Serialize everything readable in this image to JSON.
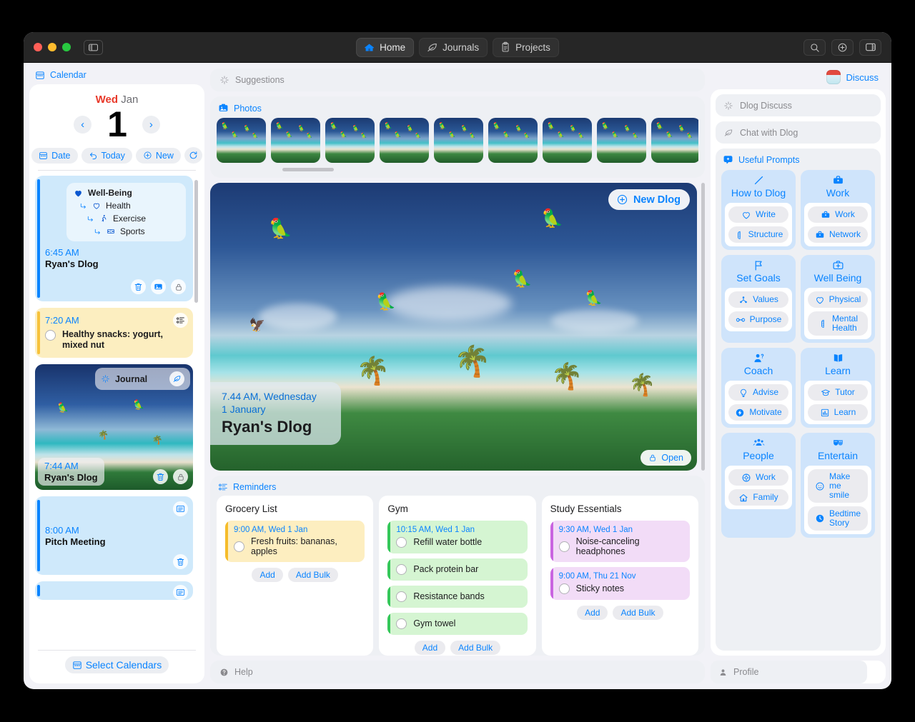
{
  "titlebar": {
    "sidebar_toggle": "sidebar-toggle",
    "tabs": [
      {
        "label": "Home",
        "icon": "home-icon",
        "active": true
      },
      {
        "label": "Journals",
        "icon": "leaf-icon",
        "active": false
      },
      {
        "label": "Projects",
        "icon": "clipboard-icon",
        "active": false
      }
    ],
    "tools": [
      "search-icon",
      "plus-icon",
      "inspector-icon"
    ]
  },
  "sidebar": {
    "section_label": "Calendar",
    "date": {
      "weekday": "Wed",
      "month": "Jan",
      "day": "1"
    },
    "prev": "‹",
    "next": "›",
    "actions": [
      {
        "label": "Date",
        "icon": "calendar-icon"
      },
      {
        "label": "Today",
        "icon": "undo-icon"
      },
      {
        "label": "New",
        "icon": "plus-circle-icon"
      }
    ],
    "refresh": "refresh-icon",
    "events": [
      {
        "type": "chips",
        "group_title": "Well-Being",
        "chips": [
          "Health",
          "Exercise",
          "Sports"
        ],
        "time": "6:45 AM",
        "title": "Ryan's Dlog",
        "icons": [
          "trash-icon",
          "photo-icon",
          "lock-icon"
        ]
      },
      {
        "type": "task",
        "time": "7:20 AM",
        "text": "Healthy snacks: yogurt, mixed nut",
        "icon": "reminders-icon"
      },
      {
        "type": "photo",
        "header": "Journal",
        "time": "7:44 AM",
        "title": "Ryan's Dlog",
        "icons": [
          "trash-icon",
          "lock-icon"
        ]
      },
      {
        "type": "plain",
        "time": "8:00 AM",
        "title": "Pitch Meeting",
        "icon": "list-icon",
        "trash": "trash-icon"
      }
    ],
    "select_calendars": "Select Calendars"
  },
  "center": {
    "suggestions": {
      "label": "Suggestions",
      "icon": "sparkle-icon"
    },
    "photos": {
      "label": "Photos",
      "icon": "photos-icon",
      "count": 10
    },
    "hero": {
      "new_dlog": "New Dlog",
      "time": "7.44 AM, Wednesday",
      "date": "1 January",
      "title": "Ryan's Dlog",
      "open": "Open"
    },
    "reminders": {
      "label": "Reminders",
      "icon": "reminders-icon",
      "lists": [
        {
          "title": "Grocery List",
          "color": "y",
          "items": [
            {
              "time": "9:00 AM, Wed 1 Jan",
              "text": "Fresh fruits: bananas, apples"
            }
          ],
          "actions": [
            "Add",
            "Add Bulk"
          ]
        },
        {
          "title": "Gym",
          "color": "g",
          "items": [
            {
              "time": "10:15 AM, Wed 1 Jan",
              "text": "Refill water bottle"
            },
            {
              "time": "",
              "text": "Pack protein bar"
            },
            {
              "time": "",
              "text": "Resistance bands"
            },
            {
              "time": "",
              "text": "Gym towel"
            }
          ],
          "actions": [
            "Add",
            "Add Bulk"
          ]
        },
        {
          "title": "Study Essentials",
          "color": "p",
          "items": [
            {
              "time": "9:30 AM, Wed 1 Jan",
              "text": "Noise-canceling headphones"
            },
            {
              "time": "9:00 AM, Thu 21 Nov",
              "text": "Sticky notes"
            }
          ],
          "actions": [
            "Add",
            "Add Bulk"
          ]
        }
      ]
    },
    "help": {
      "label": "Help",
      "icon": "help-icon"
    }
  },
  "right": {
    "discuss": {
      "label": "Discuss",
      "icon": "robot-avatar"
    },
    "bars": [
      {
        "label": "Dlog Discuss",
        "icon": "sparkle-icon"
      },
      {
        "label": "Chat with Dlog",
        "icon": "leaf-icon"
      }
    ],
    "prompts_header": {
      "label": "Useful Prompts",
      "icon": "prompt-icon"
    },
    "prompt_cards": [
      {
        "title": "How to Dlog",
        "icon": "pencil-icon",
        "buttons": [
          {
            "label": "Write",
            "icon": "heart-icon"
          },
          {
            "label": "Structure",
            "icon": "brain-icon"
          }
        ]
      },
      {
        "title": "Work",
        "icon": "briefcase-icon",
        "buttons": [
          {
            "label": "Work",
            "icon": "briefcase-icon"
          },
          {
            "label": "Network",
            "icon": "briefcase-icon"
          }
        ]
      },
      {
        "title": "Set Goals",
        "icon": "flag-icon",
        "buttons": [
          {
            "label": "Values",
            "icon": "network-icon"
          },
          {
            "label": "Purpose",
            "icon": "infinity-icon"
          }
        ]
      },
      {
        "title": "Well Being",
        "icon": "medkit-icon",
        "buttons": [
          {
            "label": "Physical",
            "icon": "heart-icon"
          },
          {
            "label": "Mental\nHealth",
            "icon": "brain-icon"
          }
        ]
      },
      {
        "title": "Coach",
        "icon": "person-question-icon",
        "buttons": [
          {
            "label": "Advise",
            "icon": "bulb-icon"
          },
          {
            "label": "Motivate",
            "icon": "bolt-icon"
          }
        ]
      },
      {
        "title": "Learn",
        "icon": "book-icon",
        "buttons": [
          {
            "label": "Tutor",
            "icon": "graduation-cap-icon"
          },
          {
            "label": "Learn",
            "icon": "chart-icon"
          }
        ]
      },
      {
        "title": "People",
        "icon": "people-icon",
        "buttons": [
          {
            "label": "Work",
            "icon": "wheel-icon"
          },
          {
            "label": "Family",
            "icon": "house-icon"
          }
        ]
      },
      {
        "title": "Entertain",
        "icon": "masks-icon",
        "buttons": [
          {
            "label": "Make\nme smile",
            "icon": "smiley-icon"
          },
          {
            "label": "Bedtime\nStory",
            "icon": "clock-icon"
          }
        ]
      }
    ],
    "profile": {
      "label": "Profile",
      "icon": "person-icon"
    }
  },
  "colors": {
    "accent": "#0a84ff",
    "red": "#e8392a",
    "panel": "#eef0f4",
    "card_blue": "#cfe9fb",
    "card_yellow": "#fceec0",
    "reminder_green": "#d5f5d2",
    "reminder_purple": "#f2dcf7"
  }
}
